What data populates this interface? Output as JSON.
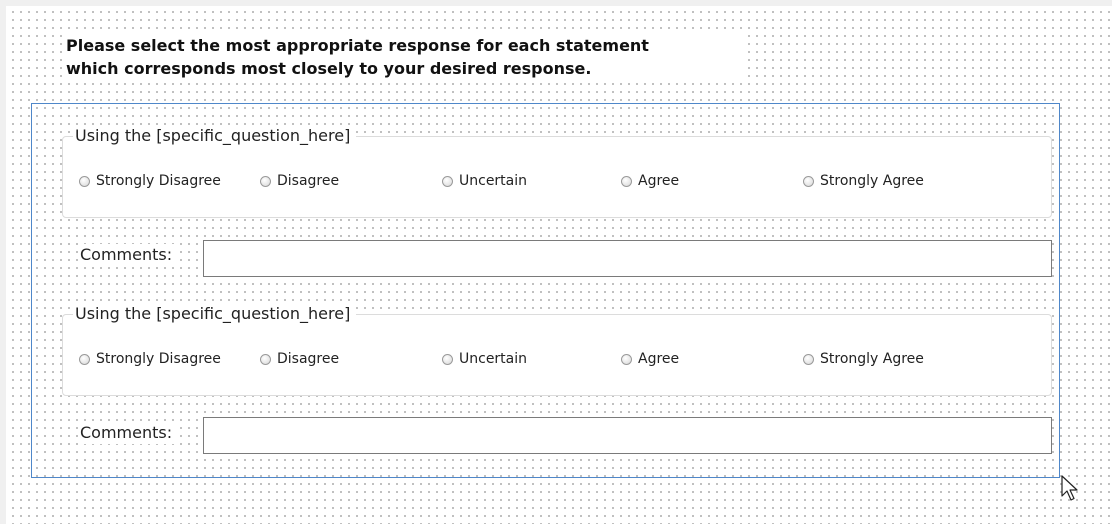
{
  "instructions": {
    "line1": "Please select the most appropriate response for each statement",
    "line2": "which corresponds most closely to your desired response."
  },
  "questions": [
    {
      "legend": "Using the [specific_question_here]",
      "options": [
        "Strongly Disagree",
        "Disagree",
        "Uncertain",
        "Agree",
        "Strongly Agree"
      ],
      "comments_label": "Comments:",
      "comments_value": ""
    },
    {
      "legend": "Using the [specific_question_here]",
      "options": [
        "Strongly Disagree",
        "Disagree",
        "Uncertain",
        "Agree",
        "Strongly Agree"
      ],
      "comments_label": "Comments:",
      "comments_value": ""
    }
  ],
  "icons": {
    "cursor": "mouse-pointer-icon",
    "radio": "radio-button-icon"
  },
  "colors": {
    "selection_frame": "#4f87c9",
    "groupbox_border": "#dcdcdc",
    "input_border": "#7a7a7a"
  }
}
